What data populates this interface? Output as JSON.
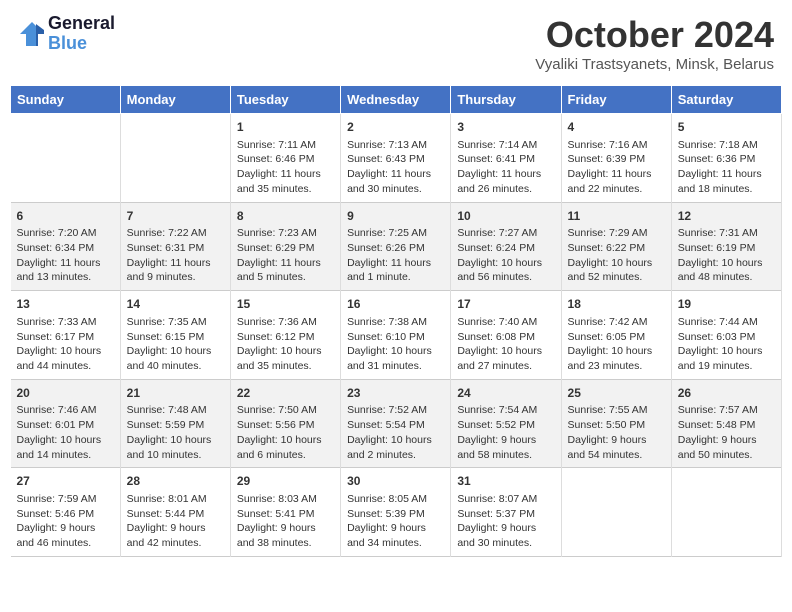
{
  "header": {
    "logo_line1": "General",
    "logo_line2": "Blue",
    "main_title": "October 2024",
    "subtitle": "Vyaliki Trastsyanets, Minsk, Belarus"
  },
  "weekdays": [
    "Sunday",
    "Monday",
    "Tuesday",
    "Wednesday",
    "Thursday",
    "Friday",
    "Saturday"
  ],
  "weeks": [
    [
      {
        "day": "",
        "content": ""
      },
      {
        "day": "",
        "content": ""
      },
      {
        "day": "1",
        "content": "Sunrise: 7:11 AM\nSunset: 6:46 PM\nDaylight: 11 hours\nand 35 minutes."
      },
      {
        "day": "2",
        "content": "Sunrise: 7:13 AM\nSunset: 6:43 PM\nDaylight: 11 hours\nand 30 minutes."
      },
      {
        "day": "3",
        "content": "Sunrise: 7:14 AM\nSunset: 6:41 PM\nDaylight: 11 hours\nand 26 minutes."
      },
      {
        "day": "4",
        "content": "Sunrise: 7:16 AM\nSunset: 6:39 PM\nDaylight: 11 hours\nand 22 minutes."
      },
      {
        "day": "5",
        "content": "Sunrise: 7:18 AM\nSunset: 6:36 PM\nDaylight: 11 hours\nand 18 minutes."
      }
    ],
    [
      {
        "day": "6",
        "content": "Sunrise: 7:20 AM\nSunset: 6:34 PM\nDaylight: 11 hours\nand 13 minutes."
      },
      {
        "day": "7",
        "content": "Sunrise: 7:22 AM\nSunset: 6:31 PM\nDaylight: 11 hours\nand 9 minutes."
      },
      {
        "day": "8",
        "content": "Sunrise: 7:23 AM\nSunset: 6:29 PM\nDaylight: 11 hours\nand 5 minutes."
      },
      {
        "day": "9",
        "content": "Sunrise: 7:25 AM\nSunset: 6:26 PM\nDaylight: 11 hours\nand 1 minute."
      },
      {
        "day": "10",
        "content": "Sunrise: 7:27 AM\nSunset: 6:24 PM\nDaylight: 10 hours\nand 56 minutes."
      },
      {
        "day": "11",
        "content": "Sunrise: 7:29 AM\nSunset: 6:22 PM\nDaylight: 10 hours\nand 52 minutes."
      },
      {
        "day": "12",
        "content": "Sunrise: 7:31 AM\nSunset: 6:19 PM\nDaylight: 10 hours\nand 48 minutes."
      }
    ],
    [
      {
        "day": "13",
        "content": "Sunrise: 7:33 AM\nSunset: 6:17 PM\nDaylight: 10 hours\nand 44 minutes."
      },
      {
        "day": "14",
        "content": "Sunrise: 7:35 AM\nSunset: 6:15 PM\nDaylight: 10 hours\nand 40 minutes."
      },
      {
        "day": "15",
        "content": "Sunrise: 7:36 AM\nSunset: 6:12 PM\nDaylight: 10 hours\nand 35 minutes."
      },
      {
        "day": "16",
        "content": "Sunrise: 7:38 AM\nSunset: 6:10 PM\nDaylight: 10 hours\nand 31 minutes."
      },
      {
        "day": "17",
        "content": "Sunrise: 7:40 AM\nSunset: 6:08 PM\nDaylight: 10 hours\nand 27 minutes."
      },
      {
        "day": "18",
        "content": "Sunrise: 7:42 AM\nSunset: 6:05 PM\nDaylight: 10 hours\nand 23 minutes."
      },
      {
        "day": "19",
        "content": "Sunrise: 7:44 AM\nSunset: 6:03 PM\nDaylight: 10 hours\nand 19 minutes."
      }
    ],
    [
      {
        "day": "20",
        "content": "Sunrise: 7:46 AM\nSunset: 6:01 PM\nDaylight: 10 hours\nand 14 minutes."
      },
      {
        "day": "21",
        "content": "Sunrise: 7:48 AM\nSunset: 5:59 PM\nDaylight: 10 hours\nand 10 minutes."
      },
      {
        "day": "22",
        "content": "Sunrise: 7:50 AM\nSunset: 5:56 PM\nDaylight: 10 hours\nand 6 minutes."
      },
      {
        "day": "23",
        "content": "Sunrise: 7:52 AM\nSunset: 5:54 PM\nDaylight: 10 hours\nand 2 minutes."
      },
      {
        "day": "24",
        "content": "Sunrise: 7:54 AM\nSunset: 5:52 PM\nDaylight: 9 hours\nand 58 minutes."
      },
      {
        "day": "25",
        "content": "Sunrise: 7:55 AM\nSunset: 5:50 PM\nDaylight: 9 hours\nand 54 minutes."
      },
      {
        "day": "26",
        "content": "Sunrise: 7:57 AM\nSunset: 5:48 PM\nDaylight: 9 hours\nand 50 minutes."
      }
    ],
    [
      {
        "day": "27",
        "content": "Sunrise: 7:59 AM\nSunset: 5:46 PM\nDaylight: 9 hours\nand 46 minutes."
      },
      {
        "day": "28",
        "content": "Sunrise: 8:01 AM\nSunset: 5:44 PM\nDaylight: 9 hours\nand 42 minutes."
      },
      {
        "day": "29",
        "content": "Sunrise: 8:03 AM\nSunset: 5:41 PM\nDaylight: 9 hours\nand 38 minutes."
      },
      {
        "day": "30",
        "content": "Sunrise: 8:05 AM\nSunset: 5:39 PM\nDaylight: 9 hours\nand 34 minutes."
      },
      {
        "day": "31",
        "content": "Sunrise: 8:07 AM\nSunset: 5:37 PM\nDaylight: 9 hours\nand 30 minutes."
      },
      {
        "day": "",
        "content": ""
      },
      {
        "day": "",
        "content": ""
      }
    ]
  ]
}
